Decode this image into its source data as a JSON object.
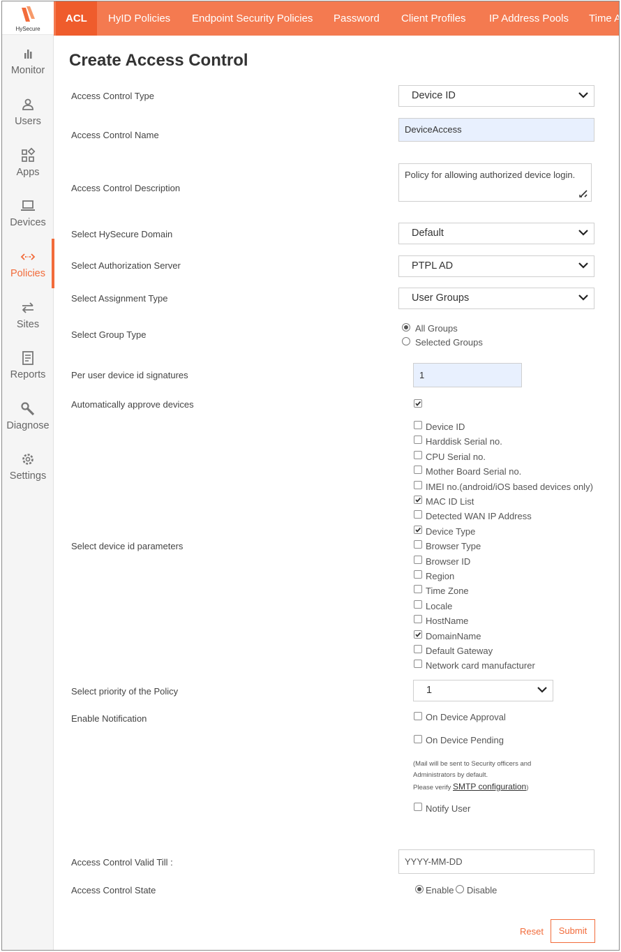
{
  "app": {
    "logo_text": "HySecure",
    "brand_color": "#f26b3a"
  },
  "sidebar": {
    "items": [
      {
        "label": "Monitor",
        "icon": "bar-chart-icon"
      },
      {
        "label": "Users",
        "icon": "user-icon"
      },
      {
        "label": "Apps",
        "icon": "apps-grid-icon"
      },
      {
        "label": "Devices",
        "icon": "laptop-icon"
      },
      {
        "label": "Policies",
        "icon": "policies-arrows-icon",
        "active": true
      },
      {
        "label": "Sites",
        "icon": "swap-arrows-icon"
      },
      {
        "label": "Reports",
        "icon": "report-icon"
      },
      {
        "label": "Diagnose",
        "icon": "wrench-icon"
      },
      {
        "label": "Settings",
        "icon": "gear-icon"
      }
    ]
  },
  "tabs": [
    "ACL",
    "HyID Policies",
    "Endpoint Security Policies",
    "Password",
    "Client Profiles",
    "IP Address Pools",
    "Time A"
  ],
  "page_title": "Create Access Control",
  "form": {
    "type": {
      "label": "Access Control Type",
      "value": "Device ID"
    },
    "name": {
      "label": "Access Control Name",
      "value": "DeviceAccess"
    },
    "description": {
      "label": "Access Control Description",
      "value": "Policy for allowing authorized device login."
    },
    "domain": {
      "label": "Select HySecure Domain",
      "value": "Default"
    },
    "auth_server": {
      "label": "Select Authorization Server",
      "value": "PTPL AD"
    },
    "assignment": {
      "label": "Select Assignment Type",
      "value": "User Groups"
    },
    "group_type": {
      "label": "Select Group Type",
      "options": [
        "All Groups",
        "Selected Groups"
      ],
      "selected": "All Groups"
    },
    "signatures": {
      "label": "Per user device id signatures",
      "value": "1"
    },
    "auto_approve": {
      "label": "Automatically approve devices",
      "checked": true
    },
    "device_params": {
      "label": "Select device id parameters",
      "options": [
        {
          "label": "Device ID",
          "checked": false
        },
        {
          "label": "Harddisk Serial no.",
          "checked": false
        },
        {
          "label": "CPU Serial no.",
          "checked": false
        },
        {
          "label": "Mother Board Serial no.",
          "checked": false
        },
        {
          "label": "IMEI no.(android/iOS based devices only)",
          "checked": false
        },
        {
          "label": "MAC ID List",
          "checked": true
        },
        {
          "label": "Detected WAN IP Address",
          "checked": false
        },
        {
          "label": "Device Type",
          "checked": true
        },
        {
          "label": "Browser Type",
          "checked": false
        },
        {
          "label": "Browser ID",
          "checked": false
        },
        {
          "label": "Region",
          "checked": false
        },
        {
          "label": "Time Zone",
          "checked": false
        },
        {
          "label": "Locale",
          "checked": false
        },
        {
          "label": "HostName",
          "checked": false
        },
        {
          "label": "DomainName",
          "checked": true
        },
        {
          "label": "Default Gateway",
          "checked": false
        },
        {
          "label": "Network card manufacturer",
          "checked": false
        }
      ]
    },
    "priority": {
      "label": "Select priority of the Policy",
      "value": "1"
    },
    "notification": {
      "label": "Enable Notification",
      "on_approval": "On Device Approval",
      "on_pending": "On Device Pending",
      "note_line1": "(Mail will be sent to Security officers and",
      "note_line2": "Administrators by default.",
      "note_line3": "Please verify",
      "smtp_link": "SMTP configuration",
      "note_end": ")",
      "notify_user": "Notify User"
    },
    "valid_till": {
      "label": "Access Control Valid Till :",
      "placeholder": "YYYY-MM-DD"
    },
    "state": {
      "label": "Access Control State",
      "options": [
        "Enable",
        "Disable"
      ],
      "selected": "Enable"
    }
  },
  "buttons": {
    "reset": "Reset",
    "submit": "Submit"
  }
}
